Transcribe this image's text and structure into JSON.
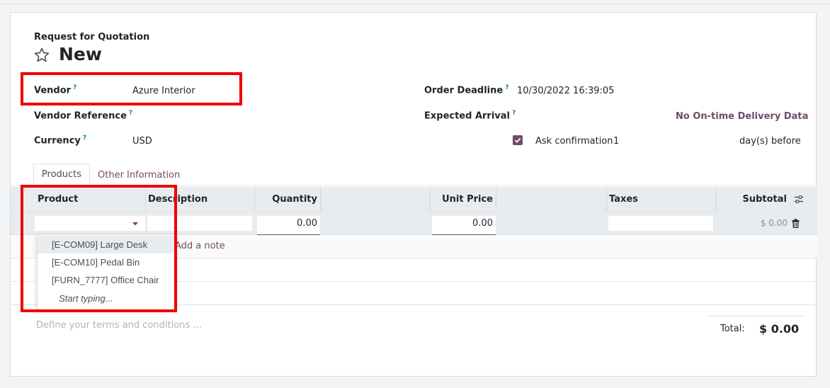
{
  "form": {
    "doc_type": "Request for Quotation",
    "title": "New"
  },
  "fields": {
    "vendor_label": "Vendor",
    "vendor_value": "Azure Interior",
    "vendor_ref_label": "Vendor Reference",
    "currency_label": "Currency",
    "currency_value": "USD",
    "order_deadline_label": "Order Deadline",
    "order_deadline_value": "10/30/2022 16:39:05",
    "expected_arrival_label": "Expected Arrival",
    "ontime_link": "No On-time Delivery Data",
    "ask_confirmation_label": "Ask confirmation",
    "ask_confirmation_days": "1",
    "days_before": "day(s) before",
    "help_mark": "?"
  },
  "tabs": {
    "products": "Products",
    "other_info": "Other Information"
  },
  "table": {
    "headers": {
      "product": "Product",
      "description": "Description",
      "quantity": "Quantity",
      "unit_price": "Unit Price",
      "taxes": "Taxes",
      "subtotal": "Subtotal"
    },
    "edit_row": {
      "quantity": "0.00",
      "unit_price": "0.00",
      "subtotal": "$ 0.00"
    },
    "add_note": "Add a note"
  },
  "dropdown": {
    "items": [
      "[E-COM09] Large Desk",
      "[E-COM10] Pedal Bin",
      "[FURN_7777] Office Chair"
    ],
    "hint": "Start typing..."
  },
  "footer": {
    "terms_placeholder": "Define your terms and conditions ...",
    "total_label": "Total:",
    "total_value": "$ 0.00"
  },
  "colors": {
    "accent": "#714b67",
    "highlight_box": "#ee0000"
  }
}
